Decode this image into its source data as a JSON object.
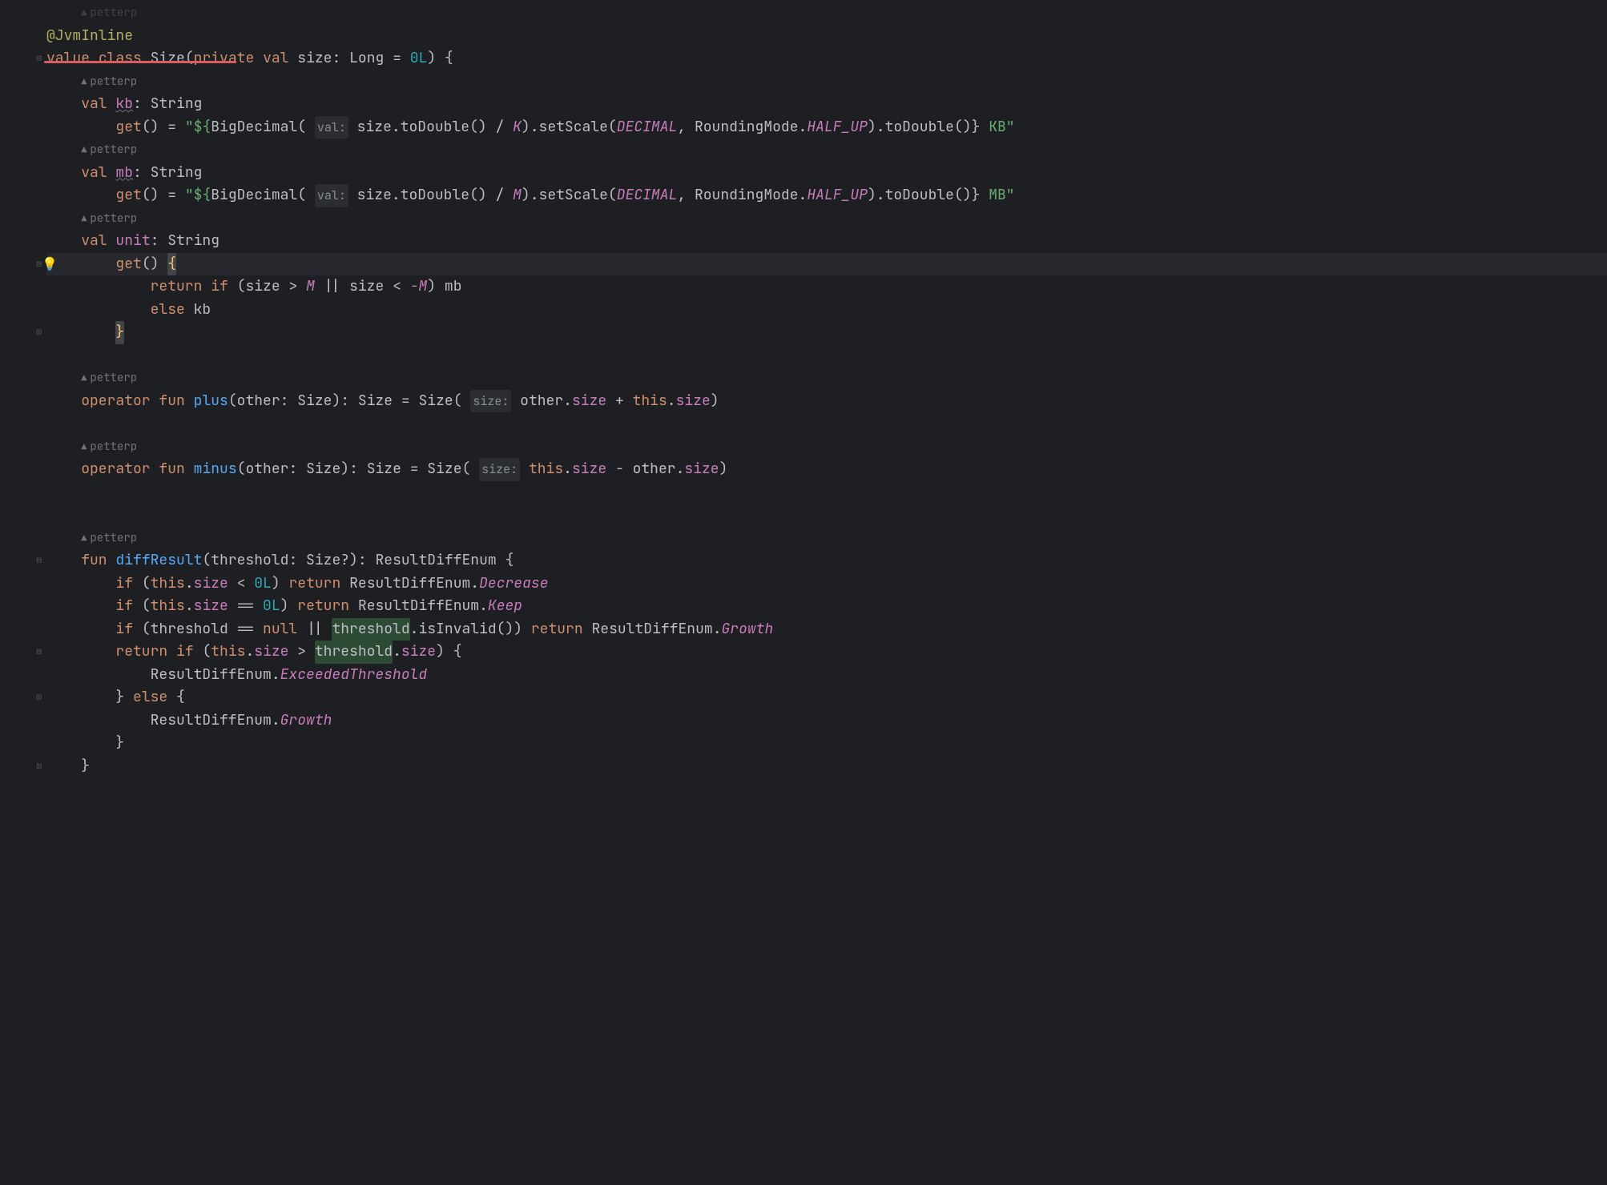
{
  "author": "petterp",
  "annotation": "@JvmInline",
  "line_decl": {
    "value": "value",
    "class": "class",
    "name": "Size",
    "private": "private",
    "val": "val",
    "param": "size",
    "type": "Long",
    "eq": " = ",
    "default": "0L",
    "open": "(",
    "close": ")",
    "brace": " {"
  },
  "kb": {
    "val": "val",
    "name": "kb",
    "type": "String",
    "get": "get",
    "parens": "()",
    "eq": " = ",
    "str_open": "\"${",
    "big": "BigDecimal",
    "hint": "val:",
    "call": "size",
    "toD": ".toDouble()",
    "div": " / ",
    "k": "K",
    "setScale": ".setScale(",
    "dec": "DECIMAL",
    "comma": ", ",
    "rm": "RoundingMode",
    "dot": ".",
    "half": "HALF_UP",
    "close": ")",
    "toD2": ".toDouble()}",
    "tail": " KB\""
  },
  "mb": {
    "val": "val",
    "name": "mb",
    "type": "String",
    "get": "get",
    "parens": "()",
    "eq": " = ",
    "str_open": "\"${",
    "big": "BigDecimal",
    "hint": "val:",
    "call": "size",
    "toD": ".toDouble()",
    "div": " / ",
    "m": "M",
    "setScale": ".setScale(",
    "dec": "DECIMAL",
    "comma": ", ",
    "rm": "RoundingMode",
    "dot": ".",
    "half": "HALF_UP",
    "close": ")",
    "toD2": ".toDouble()}",
    "tail": " MB\""
  },
  "unit": {
    "val": "val",
    "name": "unit",
    "type": "String",
    "get": "get",
    "parens": "()",
    "brace_open": "{",
    "ret": "return",
    "if": "if",
    "cond_open": " (",
    "size": "size",
    "gt": " > ",
    "m": "M",
    "or": " || ",
    "lt": " < ",
    "neg_m": "-M",
    "cond_close": ") ",
    "mb_ref": "mb",
    "else": "else",
    "kb_ref": "kb",
    "brace_close": "}"
  },
  "plus": {
    "operator": "operator",
    "fun": "fun",
    "name": "plus",
    "open": "(",
    "other": "other",
    "colon": ": ",
    "type": "Size",
    "close": ")",
    "ret_colon": ": ",
    "ret_type": "Size",
    "eq": " = ",
    "ctor": "Size",
    "ctor_open": "(",
    "hint": "size:",
    "other_ref": "other",
    "dot": ".",
    "size": "size",
    "op": " + ",
    "this": "this",
    "ctor_close": ")"
  },
  "minus": {
    "operator": "operator",
    "fun": "fun",
    "name": "minus",
    "open": "(",
    "other": "other",
    "colon": ": ",
    "type": "Size",
    "close": ")",
    "ret_colon": ": ",
    "ret_type": "Size",
    "eq": " = ",
    "ctor": "Size",
    "ctor_open": "(",
    "hint": "size:",
    "this": "this",
    "dot": ".",
    "size": "size",
    "op": " - ",
    "other_ref": "other",
    "ctor_close": ")"
  },
  "diff": {
    "fun": "fun",
    "name": "diffResult",
    "open": "(",
    "param": "threshold",
    "colon": ": ",
    "type": "Size?",
    "close": ")",
    "ret_colon": ": ",
    "ret_type": "ResultDiffEnum",
    "brace": " {",
    "if1": "if",
    "cond1_open": " (",
    "this": "this",
    "dot": ".",
    "size": "size",
    "lt": " < ",
    "zero": "0L",
    "cond1_close": ") ",
    "ret": "return",
    "enum": "ResultDiffEnum",
    "decrease": "Decrease",
    "if2": "if",
    "eqeq": " == ",
    "keep": "Keep",
    "if3": "if",
    "thr": "threshold",
    "isnull": " == ",
    "null": "null",
    "or": " || ",
    "isinv": ".isInvalid()",
    "growth": "Growth",
    "ret_if": "return",
    "if4": "if",
    "gt": " > ",
    "thr_size": "threshold",
    "brace_open": " {",
    "exceeded": "ExceededThreshold",
    "else": "else",
    "brace_close": "}",
    "close_brace": "}"
  }
}
